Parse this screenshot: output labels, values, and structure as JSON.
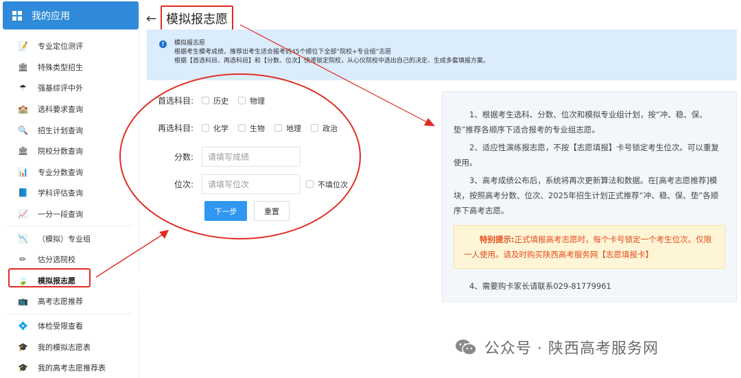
{
  "sidebar": {
    "title": "我的应用",
    "items": [
      {
        "label": "专业定位测评",
        "icon": "📝"
      },
      {
        "label": "特殊类型招生",
        "icon": "🏛"
      },
      {
        "label": "强基综评中外",
        "icon": "☂"
      },
      {
        "label": "选科要求查询",
        "icon": "🏫"
      },
      {
        "label": "招生计划查询",
        "icon": "🔍"
      },
      {
        "label": "院校分数查询",
        "icon": "🏛"
      },
      {
        "label": "专业分数查询",
        "icon": "📊"
      },
      {
        "label": "学科评估查询",
        "icon": "📘"
      },
      {
        "label": "一分一段查询",
        "icon": "📈"
      },
      {
        "label": "（模拟）专业组",
        "icon": "📉"
      },
      {
        "label": "估分选院校",
        "icon": "✏"
      },
      {
        "label": "模拟报志愿",
        "icon": "🍃"
      },
      {
        "label": "高考志愿推荐",
        "icon": "📺"
      },
      {
        "label": "体检受限查看",
        "icon": "💠"
      },
      {
        "label": "我的模拟志愿表",
        "icon": "🎓"
      },
      {
        "label": "我的高考志愿推荐表",
        "icon": "🎓"
      }
    ]
  },
  "page": {
    "title": "模拟报志愿"
  },
  "notice": {
    "title": "模拟报志愿",
    "line1": "根据考生模考成绩，推荐出考生适合报考的45个顺位下全部“院校+专业组”志愿",
    "line2": "根据【首选科目、再选科目】和【分数、位次】快速锁定院校，从心仪院校中选出自己的决定、生成多套填报方案。"
  },
  "form": {
    "first_subject_label": "首选科目:",
    "first_subjects": [
      "历史",
      "物理"
    ],
    "second_subject_label": "再选科目:",
    "second_subjects": [
      "化学",
      "生物",
      "地理",
      "政治"
    ],
    "score_label": "分数:",
    "score_placeholder": "请填写成绩",
    "rank_label": "位次:",
    "rank_placeholder": "请填写位次",
    "no_rank_label": "不填位次",
    "next_button": "下一步",
    "reset_button": "重置"
  },
  "panel": {
    "p1": "1、根据考生选科、分数、位次和模拟专业组计划，按“冲、稳、保、垫”推荐各顺序下适合报考的专业组志愿。",
    "p2": "2、适应性演练报志愿，不按【志愿填报】卡号锁定考生位次。可以重复使用。",
    "p3": "3、高考成绩公布后，系统将再次更新算法和数据。在[高考志愿推荐]模块，按照高考分数、位次、2025年招生计划正式推荐“冲、稳、保、垫”各顺序下高考志愿。",
    "tip_label": "特别提示:",
    "tip_text": "正式填报高考志愿时，每个卡号锁定一个考生位次。仅限一人使用。请及时购买陕西高考服务网【志愿填报卡】",
    "p4": "4、需要购卡家长请联系029-81779961"
  },
  "watermark": {
    "text": "公众号 · 陕西高考服务网"
  },
  "colors": {
    "brand": "#2f8bd9",
    "annotation_red": "#e02c22",
    "notice_bg": "#dbecfd",
    "tip_text": "#e64b1f"
  }
}
